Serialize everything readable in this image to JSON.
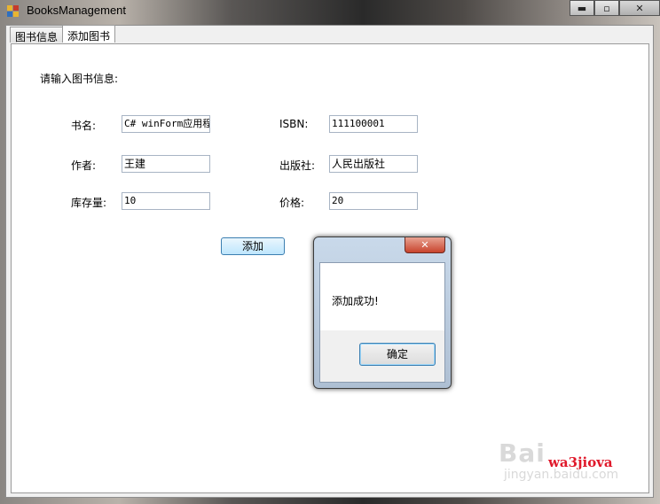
{
  "window": {
    "title": "BooksManagement"
  },
  "caption": {
    "minimize": "▬",
    "maximize": "▫",
    "close": "✕"
  },
  "tabs": [
    {
      "label": "图书信息"
    },
    {
      "label": "添加图书"
    }
  ],
  "form": {
    "prompt": "请输入图书信息:",
    "title_label": "书名:",
    "title_value": "C# winForm应用程",
    "isbn_label": "ISBN:",
    "isbn_value": "111100001",
    "author_label": "作者:",
    "author_value": "王建",
    "publisher_label": "出版社:",
    "publisher_value": "人民出版社",
    "stock_label": "库存量:",
    "stock_value": "10",
    "price_label": "价格:",
    "price_value": "20",
    "add_button": "添加"
  },
  "message_box": {
    "close": "✕",
    "text": "添加成功!",
    "ok_button": "确定"
  },
  "watermark": {
    "main": "Bai",
    "sub": "jingyan.baidu.com",
    "user": "wa3jiova"
  },
  "colors": {
    "accent_red": "#e0192b",
    "button_border": "#3c7fb1"
  }
}
